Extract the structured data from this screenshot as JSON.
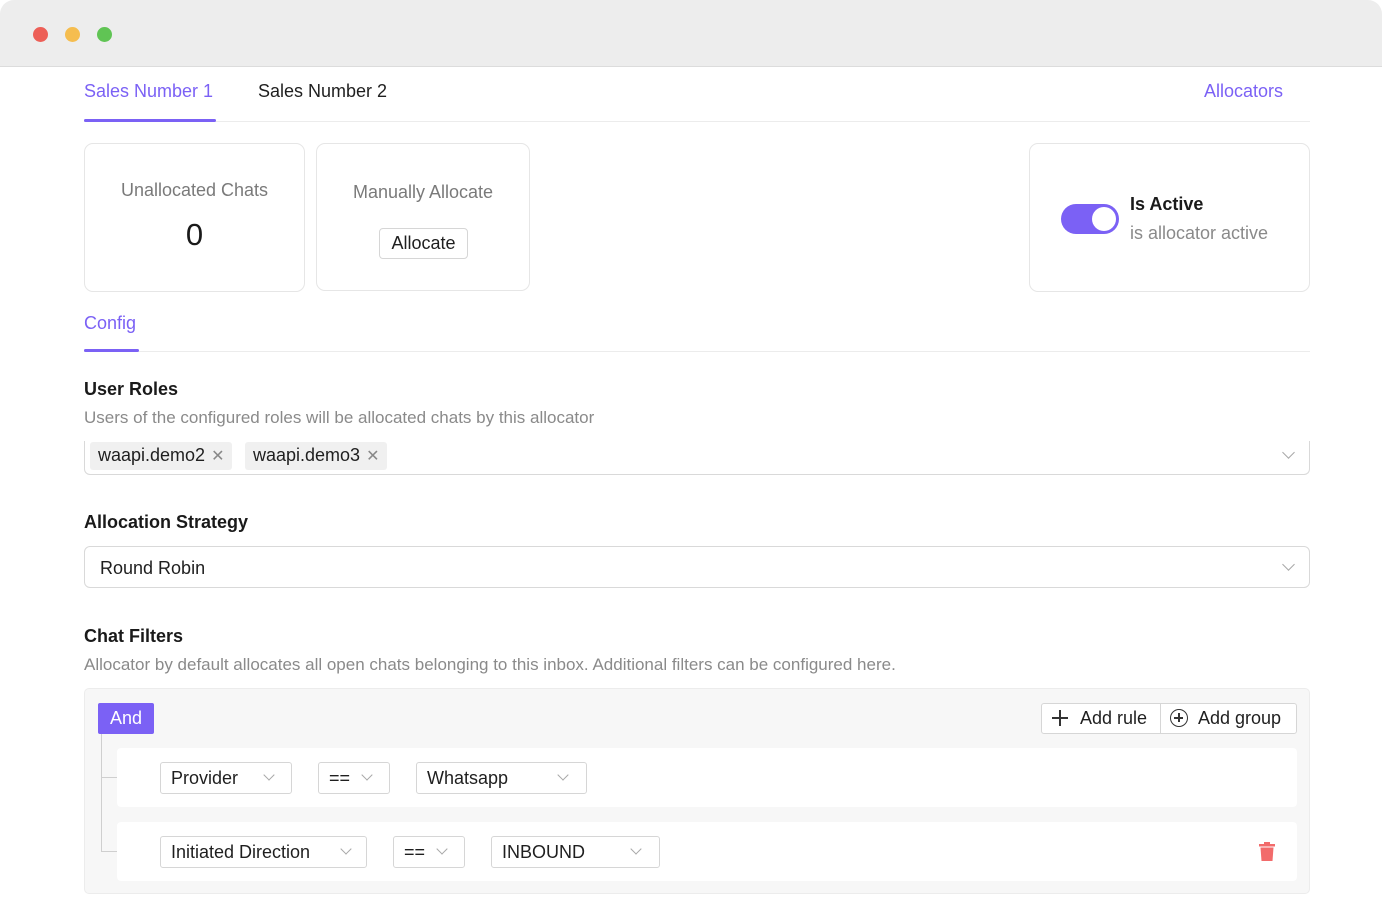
{
  "tabs": [
    {
      "label": "Sales Number 1",
      "active": true
    },
    {
      "label": "Sales Number 2",
      "active": false
    }
  ],
  "allocators_link": "Allocators",
  "cards": {
    "unallocated": {
      "label": "Unallocated Chats",
      "value": "0"
    },
    "manual": {
      "label": "Manually Allocate",
      "button": "Allocate"
    },
    "active": {
      "title": "Is Active",
      "subtitle": "is allocator active",
      "on": true
    }
  },
  "config_tab": "Config",
  "user_roles": {
    "title": "User Roles",
    "description": "Users of the configured roles will be allocated chats by this allocator",
    "tags": [
      "waapi.demo2",
      "waapi.demo3"
    ]
  },
  "allocation_strategy": {
    "title": "Allocation Strategy",
    "value": "Round Robin"
  },
  "chat_filters": {
    "title": "Chat Filters",
    "description": "Allocator by default allocates all open chats belonging to this inbox. Additional filters can be configured here.",
    "combinator": "And",
    "add_rule": "Add rule",
    "add_group": "Add group",
    "rules": [
      {
        "field": "Provider",
        "operator": "==",
        "value": "Whatsapp"
      },
      {
        "field": "Initiated Direction",
        "operator": "==",
        "value": "INBOUND"
      }
    ]
  },
  "colors": {
    "accent": "#7b61f5",
    "delete": "#f26b6b"
  }
}
